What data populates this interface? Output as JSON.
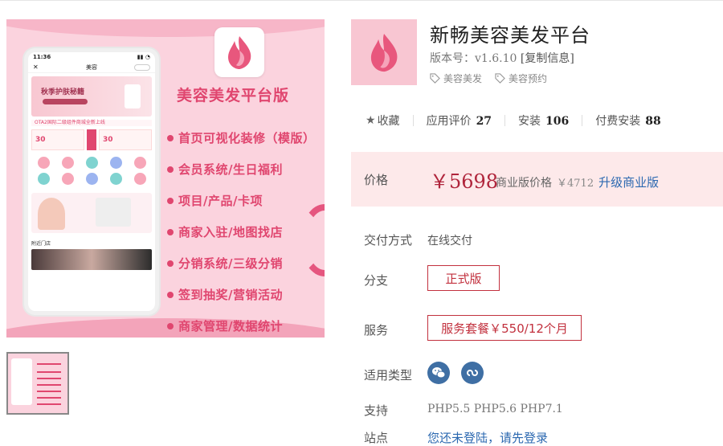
{
  "banner": {
    "title": "美容美发平台版",
    "features": [
      "首页可视化装修（模版）",
      "会员系统/生日福利",
      "项目/产品/卡项",
      "商家入驻/地图找店",
      "分销系统/三级分销",
      "签到抽奖/营销活动",
      "商家管理/数据统计"
    ],
    "phone": {
      "time": "11:36",
      "nav_title": "美容",
      "banner_text": "秋季护肤秘籍",
      "notice": "OTA2国际二级组件商城全新上线",
      "coupons": [
        "30",
        "30"
      ],
      "store_label": "附近门店"
    }
  },
  "app": {
    "title": "新畅美容美发平台",
    "version_label": "版本号：",
    "version": "v1.6.10",
    "copy_info": "[复制信息]",
    "tags": [
      "美容美发",
      "美容预约"
    ],
    "stats": {
      "favorite": "收藏",
      "rating_label": "应用评价",
      "rating": "27",
      "install_label": "安装",
      "installs": "106",
      "paid_label": "付费安装",
      "paid": "88"
    },
    "price": {
      "label": "价格",
      "value": "￥5698",
      "biz_label": "商业版价格",
      "biz_price": "￥4712",
      "upgrade": "升级商业版"
    },
    "delivery": {
      "label": "交付方式",
      "value": "在线交付"
    },
    "branch": {
      "label": "分支",
      "value": "正式版"
    },
    "service": {
      "label": "服务",
      "value": "服务套餐￥550/12个月"
    },
    "types": {
      "label": "适用类型"
    },
    "support": {
      "label": "支持",
      "value": "PHP5.5 PHP5.6 PHP7.1"
    },
    "site": {
      "label": "站点",
      "value": "您还未登陆，请先登录"
    }
  },
  "colors": {
    "accent": "#e0466f",
    "price": "#b0253c",
    "link": "#2b68b0",
    "pricebox": "#fde9ea"
  }
}
